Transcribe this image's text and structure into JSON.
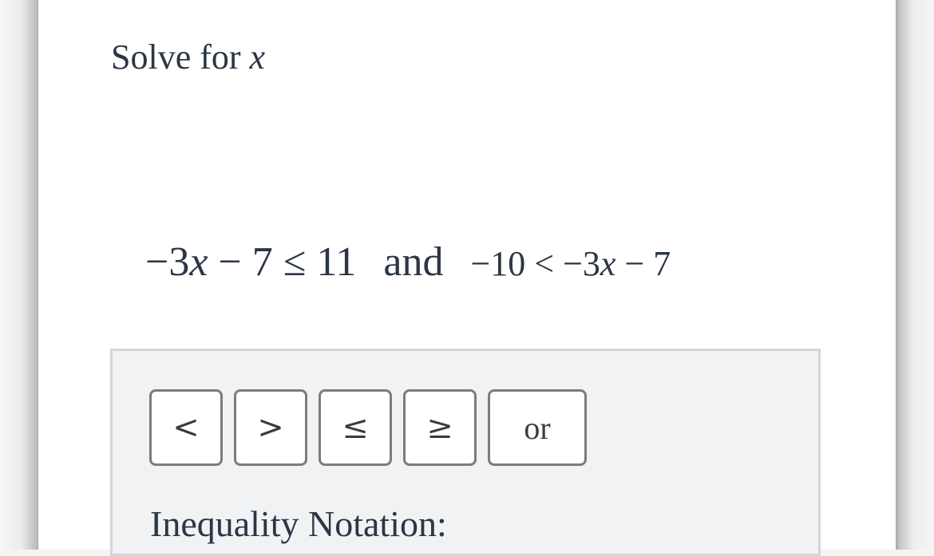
{
  "question": {
    "prompt_text": "Solve for",
    "prompt_variable": "x"
  },
  "equation": {
    "left": {
      "expr_a": "−3",
      "var": "x",
      "expr_b": " − 7 ≤ 11"
    },
    "connector": "and",
    "right": {
      "expr_a": "−10 < −3",
      "var": "x",
      "expr_b": " − 7"
    }
  },
  "answer_panel": {
    "buttons": [
      {
        "label": "<",
        "name": "less-than-button"
      },
      {
        "label": ">",
        "name": "greater-than-button"
      },
      {
        "label": "≤",
        "name": "less-than-or-equal-button"
      },
      {
        "label": "≥",
        "name": "greater-than-or-equal-button"
      },
      {
        "label": "or",
        "name": "or-button"
      }
    ],
    "notation_label": "Inequality Notation:"
  },
  "colors": {
    "text": "#2b3645",
    "panel_bg": "#f1f2f4",
    "panel_border": "#d3d6da",
    "button_border": "#7c7c7c"
  }
}
